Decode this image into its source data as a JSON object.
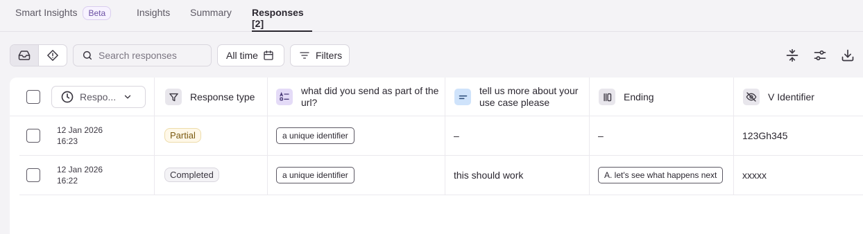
{
  "tabs": [
    {
      "label": "Smart Insights",
      "badge": "Beta"
    },
    {
      "label": "Insights"
    },
    {
      "label": "Summary"
    },
    {
      "label": "Responses [2]",
      "active": true
    }
  ],
  "toolbar": {
    "search_placeholder": "Search responses",
    "time_filter": "All time",
    "filters_label": "Filters"
  },
  "table": {
    "sort_selector_label": "Respo...",
    "columns": [
      {
        "label": "Response type",
        "icon": "funnel-icon"
      },
      {
        "label": "what did you send as part of the url?",
        "icon": "multiple-choice-icon",
        "icon_bg": "#e4dbf7"
      },
      {
        "label": "tell us more about your use case please",
        "icon": "text-lines-icon",
        "icon_bg": "#cfe3fb"
      },
      {
        "label": "Ending",
        "icon": "ending-icon",
        "icon_bg": "#e8e6ec"
      },
      {
        "label": "V Identifier",
        "icon": "eye-off-icon",
        "icon_bg": "#e8e6ec"
      }
    ],
    "rows": [
      {
        "date": "12 Jan 2026",
        "time": "16:23",
        "type": "Partial",
        "url_value": "a unique identifier",
        "use_case": "–",
        "ending": "–",
        "identifier": "123Gh345"
      },
      {
        "date": "12 Jan 2026",
        "time": "16:22",
        "type": "Completed",
        "url_value": "a unique identifier",
        "use_case": "this should work",
        "ending": "A. let's see what happens next",
        "identifier": "xxxxx"
      }
    ]
  },
  "colors": {
    "accent": "#2b2730",
    "partial_badge": "#fff8e8",
    "beta_badge": "#f7f2ff"
  }
}
